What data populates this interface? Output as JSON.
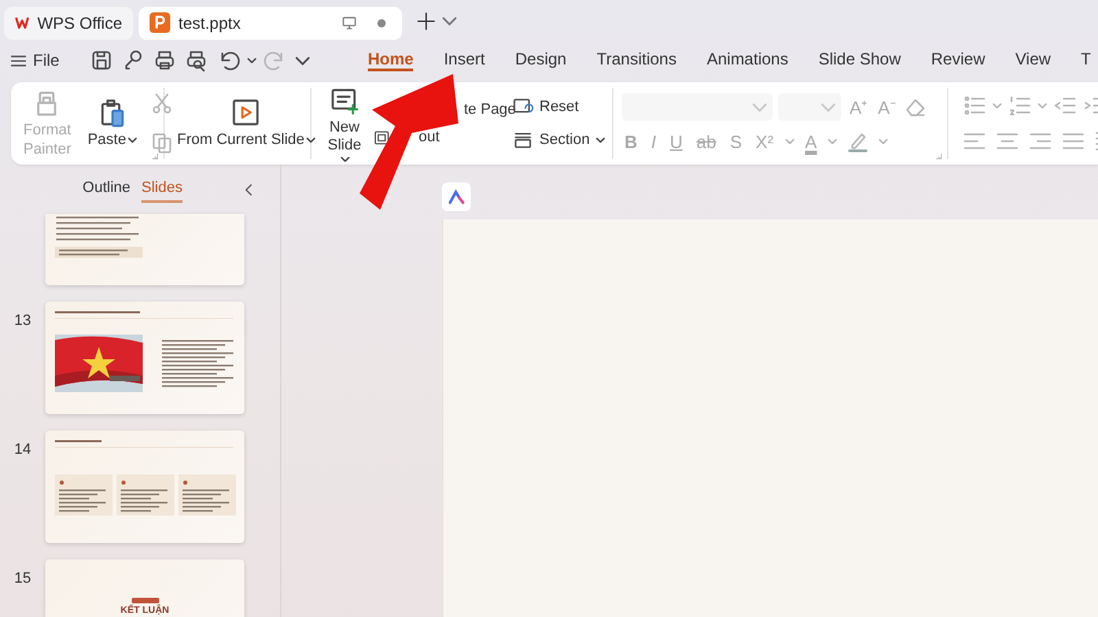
{
  "app_tabs": [
    {
      "label": "WPS Office",
      "kind": "home",
      "selected": false
    },
    {
      "label": "test.pptx",
      "kind": "document",
      "selected": true
    }
  ],
  "quick_access": {
    "menu_label": "File",
    "redo": {
      "disabled": true
    }
  },
  "ribbon_tabs": [
    {
      "label": "Home",
      "selected": true
    },
    {
      "label": "Insert",
      "selected": false
    },
    {
      "label": "Design",
      "selected": false
    },
    {
      "label": "Transitions",
      "selected": false
    },
    {
      "label": "Animations",
      "selected": false
    },
    {
      "label": "Slide Show",
      "selected": false
    },
    {
      "label": "Review",
      "selected": false
    },
    {
      "label": "View",
      "selected": false
    },
    {
      "label": "T",
      "selected": false
    }
  ],
  "ribbon": {
    "clipboard": {
      "format_painter": {
        "label": "Format Painter",
        "disabled": true
      },
      "paste": {
        "label": "Paste",
        "disabled": false
      },
      "cut": {
        "disabled": true
      },
      "copy": {
        "disabled": true
      }
    },
    "slideshow": {
      "from_current_slide": {
        "label": "From Current Slide"
      }
    },
    "slides": {
      "new_slide": {
        "label": "New Slide"
      },
      "duplicate_page": {
        "label": "te Page"
      },
      "layout": {
        "label": "out"
      },
      "reset": {
        "label": "Reset"
      },
      "section": {
        "label": "Section"
      }
    },
    "font": {
      "disabled": true,
      "grow": "A⁺",
      "shrink": "A⁻",
      "format_buttons": [
        {
          "label": "B",
          "kind": "bold"
        },
        {
          "label": "I",
          "kind": "italic"
        },
        {
          "label": "U",
          "kind": "underline"
        },
        {
          "label": "ab",
          "kind": "strike"
        },
        {
          "label": "S",
          "kind": "shadow"
        },
        {
          "label": "X²",
          "kind": "superscript"
        },
        {
          "label": "A",
          "kind": "color"
        }
      ]
    },
    "paragraph": {
      "disabled": true
    }
  },
  "slide_panel": {
    "tabs": [
      {
        "label": "Outline",
        "selected": false
      },
      {
        "label": "Slides",
        "selected": true
      }
    ],
    "slides": [
      {
        "kind": "text"
      },
      {
        "number": "13",
        "kind": "image-text"
      },
      {
        "number": "14",
        "kind": "cards"
      },
      {
        "number": "15",
        "kind": "conclusion",
        "title": "KẾT LUẬN"
      }
    ]
  }
}
